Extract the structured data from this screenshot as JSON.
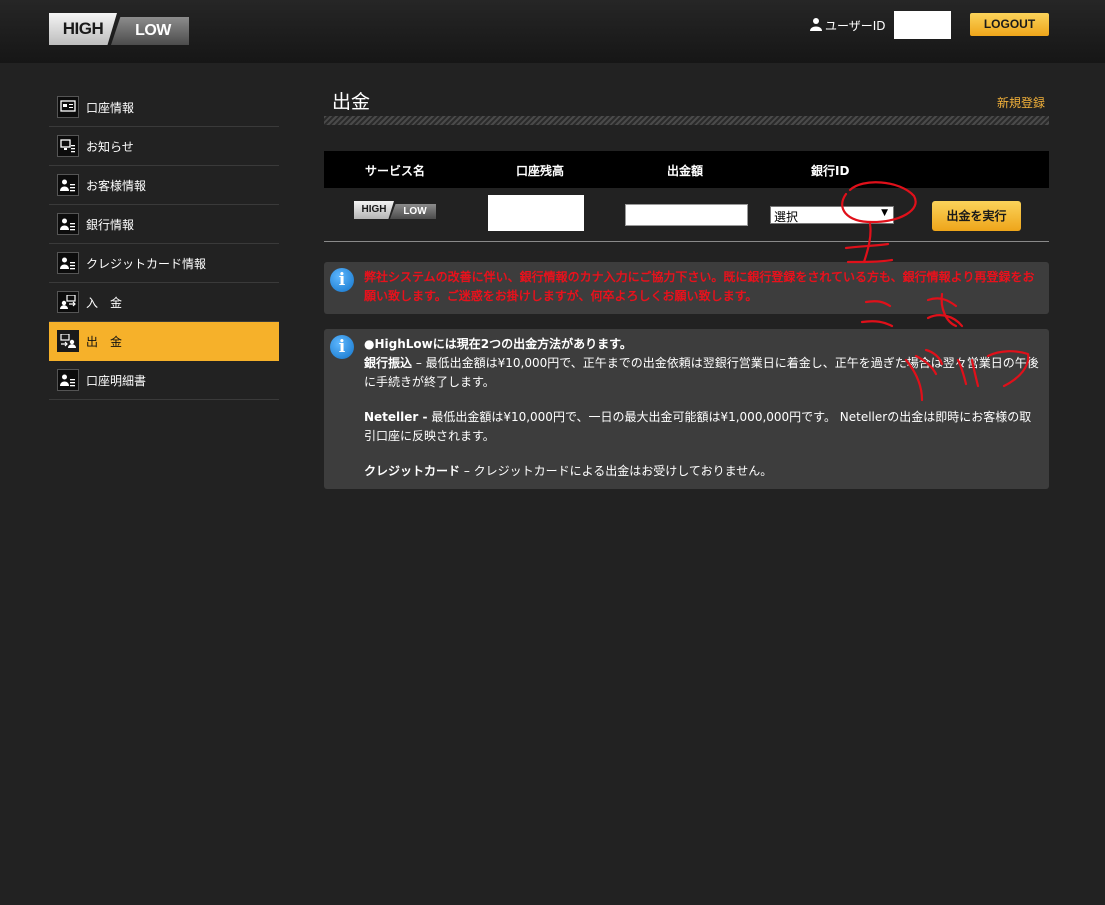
{
  "header": {
    "logo_high": "HIGH",
    "logo_low": "LOW",
    "user_label": "ユーザーID",
    "logout_label": "LOGOUT"
  },
  "sidebar": {
    "items": [
      {
        "label": "口座情報",
        "icon": "account-card-icon",
        "active": false
      },
      {
        "label": "お知らせ",
        "icon": "notice-monitor-icon",
        "active": false
      },
      {
        "label": "お客様情報",
        "icon": "customer-profile-icon",
        "active": false
      },
      {
        "label": "銀行情報",
        "icon": "bank-profile-icon",
        "active": false
      },
      {
        "label": "クレジットカード情報",
        "icon": "credit-card-profile-icon",
        "active": false
      },
      {
        "label": "入　金",
        "icon": "deposit-icon",
        "active": false
      },
      {
        "label": "出　金",
        "icon": "withdraw-icon",
        "active": true
      },
      {
        "label": "口座明細書",
        "icon": "statement-icon",
        "active": false
      }
    ]
  },
  "main": {
    "title": "出金",
    "register_link": "新規登録",
    "table": {
      "headers": [
        "サービス名",
        "口座残高",
        "出金額",
        "銀行ID"
      ],
      "service_logo_high": "HIGH",
      "service_logo_low": "LOW",
      "amount_value": "",
      "bank_select_value": "選択",
      "execute_label": "出金を実行"
    },
    "warning_text": "弊社システムの改善に伴い、銀行情報のカナ入力にご協力下さい。既に銀行登録をされている方も、銀行情報より再登録をお願い致します。ご迷惑をお掛けしますが、何卒よろしくお願い致します。",
    "info": {
      "heading": "●HighLowには現在2つの出金方法があります。",
      "bank_title": "銀行振込",
      "bank_text": " – 最低出金額は¥10,000円で、正午までの出金依頼は翌銀行営業日に着金し、正午を過ぎた場合は翌々営業日の午後に手続きが終了します。",
      "neteller_title": "Neteller -",
      "neteller_text": " 最低出金額は¥10,000円で、一日の最大出金可能額は¥1,000,000円です。 Netellerの出金は即時にお客様の取引口座に反映されます。",
      "card_title": "クレジットカード",
      "card_text": " – クレジットカードによる出金はお受けしておりません。"
    }
  },
  "colors": {
    "accent": "#f6b12a",
    "background": "#222222",
    "warning": "#e8111c",
    "annotation": "#e0101a"
  }
}
